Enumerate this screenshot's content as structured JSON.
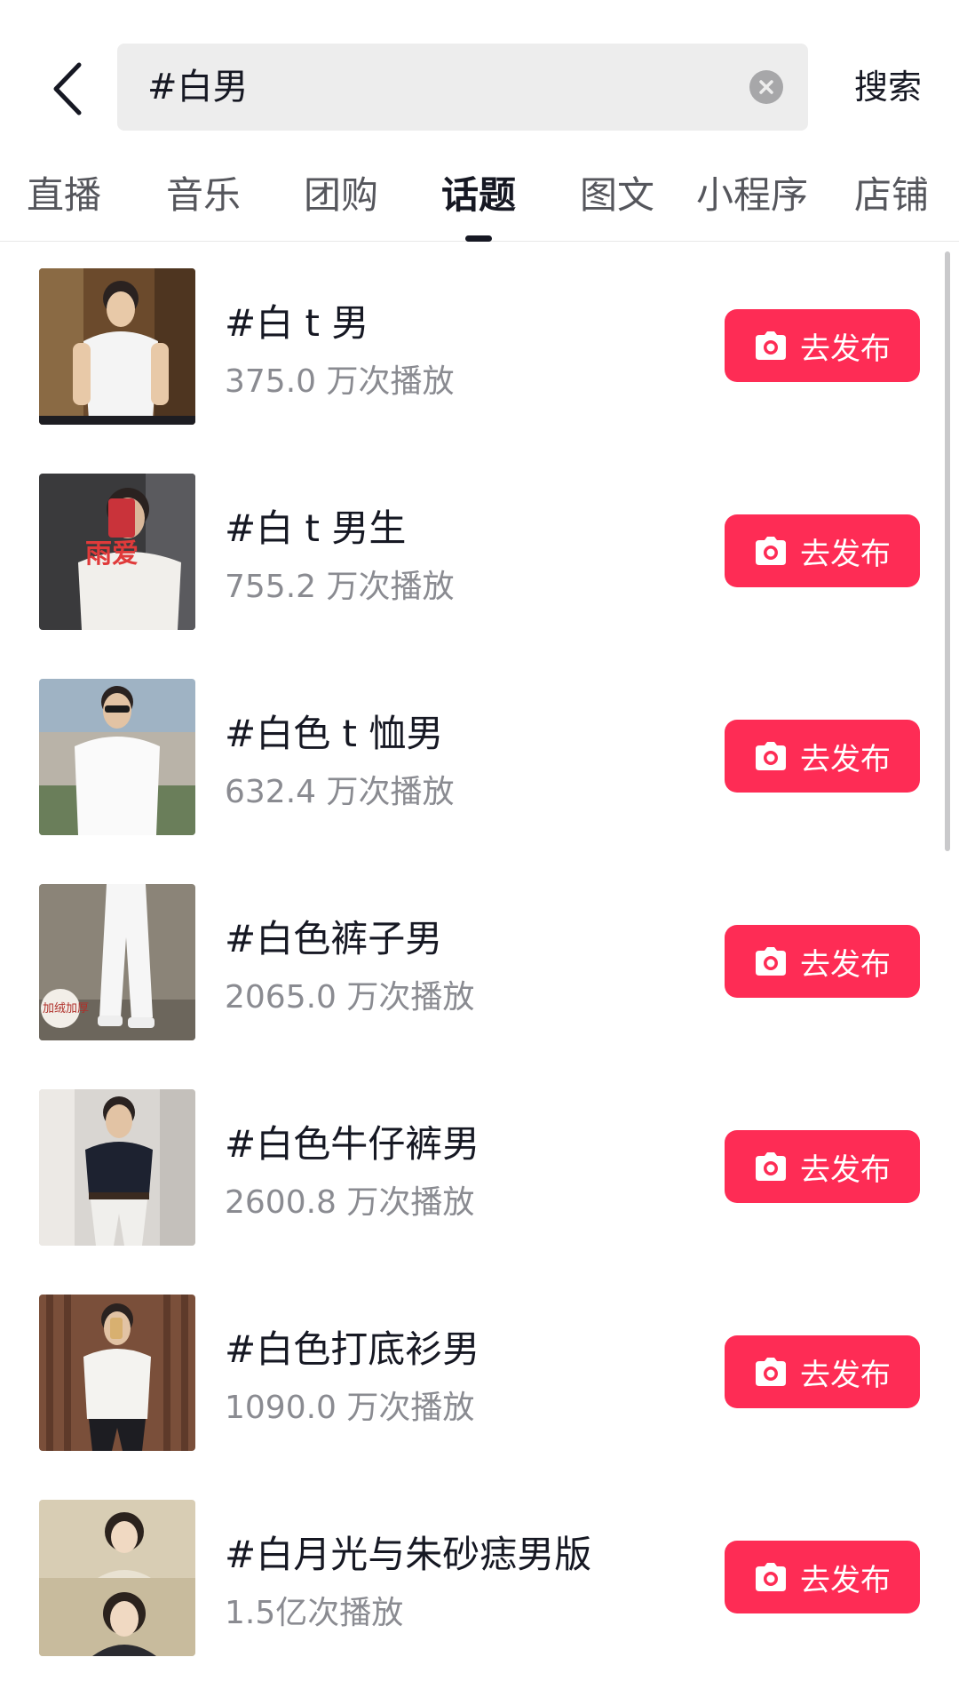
{
  "header": {
    "search_query": "#白男",
    "search_action": "搜索"
  },
  "tabs": [
    {
      "label": "直播",
      "active": false
    },
    {
      "label": "音乐",
      "active": false
    },
    {
      "label": "团购",
      "active": false
    },
    {
      "label": "话题",
      "active": true
    },
    {
      "label": "图文",
      "active": false
    },
    {
      "label": "小程序",
      "active": false
    },
    {
      "label": "店铺",
      "active": false
    }
  ],
  "topics": [
    {
      "title": "#白 t 男",
      "stats": "375.0 万次播放",
      "button": "去发布",
      "thumb_icon": "white-tshirt-man-photo"
    },
    {
      "title": "#白 t 男生",
      "stats": "755.2 万次播放",
      "button": "去发布",
      "thumb_icon": "mirror-selfie-photo",
      "thumb_text": "雨爱"
    },
    {
      "title": "#白色 t 恤男",
      "stats": "632.4 万次播放",
      "button": "去发布",
      "thumb_icon": "man-sunglasses-photo"
    },
    {
      "title": "#白色裤子男",
      "stats": "2065.0 万次播放",
      "button": "去发布",
      "thumb_icon": "white-pants-photo",
      "thumb_text": "加绒加厚"
    },
    {
      "title": "#白色牛仔裤男",
      "stats": "2600.8 万次播放",
      "button": "去发布",
      "thumb_icon": "man-polo-photo"
    },
    {
      "title": "#白色打底衫男",
      "stats": "1090.0 万次播放",
      "button": "去发布",
      "thumb_icon": "white-turtleneck-photo"
    },
    {
      "title": "#白月光与朱砂痣男版",
      "stats": "1.5亿次播放",
      "button": "去发布",
      "thumb_icon": "drama-still-photo"
    }
  ],
  "colors": {
    "accent": "#fe2c55",
    "text_primary": "#161823",
    "text_secondary": "#8a8b91",
    "search_bg": "#ededed"
  }
}
